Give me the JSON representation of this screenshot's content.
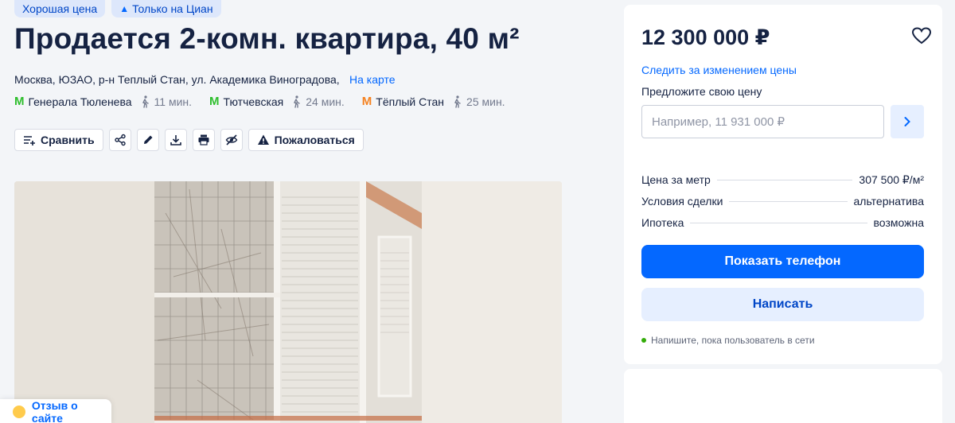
{
  "badges": [
    {
      "label": "Хорошая цена"
    },
    {
      "label": "Только на Циан",
      "icon": "cian-arrow-icon"
    }
  ],
  "title": "Продается 2-комн. квартира, 40 м²",
  "address": "Москва, ЮЗАО, р-н Теплый Стан, ул. Академика Виноградова,",
  "map_link": "На карте",
  "metro": [
    {
      "station": "Генерала Тюленева",
      "time": "11 мин.",
      "color": "#2dbe2c"
    },
    {
      "station": "Тютчевская",
      "time": "24 мин.",
      "color": "#2dbe2c"
    },
    {
      "station": "Тёплый Стан",
      "time": "25 мин.",
      "color": "#f58220"
    }
  ],
  "actions": {
    "compare": "Сравнить",
    "complain": "Пожаловаться",
    "icons": [
      "share-icon",
      "edit-icon",
      "download-icon",
      "print-icon",
      "hide-icon"
    ]
  },
  "feedback": "Отзыв о сайте",
  "sidebar": {
    "price": "12 300 000 ₽",
    "track_price": "Следить за изменением цены",
    "offer_label": "Предложите свою цену",
    "offer_placeholder": "Например, 11 931 000 ₽",
    "facts": [
      {
        "key": "Цена за метр",
        "value": "307 500 ₽/м²"
      },
      {
        "key": "Условия сделки",
        "value": "альтернатива"
      },
      {
        "key": "Ипотека",
        "value": "возможна"
      }
    ],
    "show_phone": "Показать телефон",
    "write": "Написать",
    "online_note": "Напишите, пока пользователь в сети"
  },
  "colors": {
    "accent": "#0468ff",
    "text": "#152242",
    "online": "#34ac0a"
  }
}
